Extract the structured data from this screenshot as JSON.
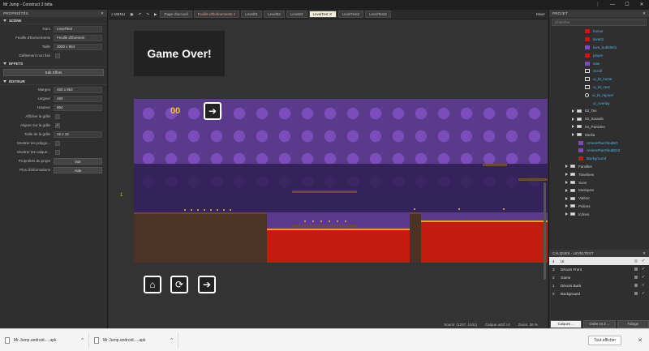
{
  "window": {
    "title": "Mr Jump - Construct 3 béta",
    "more": "⋮",
    "minimize": "—",
    "maximize": "☐",
    "close": "✕"
  },
  "properties": {
    "header": "PROPRIÉTÉS",
    "close": "✕",
    "scene_title": "SCÈNE",
    "effects_title": "EFFETS",
    "editor_title": "ÉDITEUR",
    "rows": {
      "name_label": "Nom",
      "name_value": "LevelTest",
      "sheet_label": "Feuille d'Événements",
      "sheet_value": "Feuille d'Événem",
      "size_label": "Taille",
      "size_value": "3000 x 854",
      "unbounded_label": "Défilement non fixé",
      "edit_effects": "Edit Effets",
      "margins_label": "Marges",
      "margins_value": "450 x 854",
      "width_label": "Largeur",
      "width_value": "450",
      "height_label": "Hauteur",
      "height_value": "854",
      "show_grid_label": "Afficher la grille",
      "snap_grid_label": "Aligner sur la grille",
      "snap_grid_check": "✓",
      "grid_size_label": "Taille de la grille",
      "grid_size_value": "16 x 16",
      "show_poly_label": "Montrer les polygo...",
      "show_layers_label": "Montrer les calque...",
      "project_props_label": "Propriétés du projet",
      "project_props_btn": "Voir",
      "more_info_label": "Plus d'informations",
      "more_info_btn": "Aide"
    }
  },
  "toolbar": {
    "menu": "≡ MENU",
    "tabs": [
      "Page d'accueil",
      "Feuille d'Événements 1",
      "Level01",
      "Level02",
      "Level03",
      "LevelTest",
      "LevelTest2",
      "LevelTest3"
    ],
    "active_close": "✕",
    "right": "Mixer"
  },
  "canvas": {
    "game_over": "Game Over!",
    "score": "00",
    "arrow": "➔",
    "home": "⌂",
    "restart": "⟳",
    "next": "➔",
    "side_marker": "1",
    "status": {
      "mouse": "Souris: (1207, 1041)",
      "layer": "Calque actif: UI",
      "zoom": "Zoom: 36 %"
    }
  },
  "project": {
    "header": "PROJET",
    "close": "✕",
    "search_placeholder": "Chercher",
    "items": [
      {
        "label": "bonus",
        "type": "sprite",
        "icon": "red"
      },
      {
        "label": "lava01",
        "type": "sprite",
        "icon": "red"
      },
      {
        "label": "lava_bubble01",
        "type": "sprite",
        "icon": "purple"
      },
      {
        "label": "player",
        "type": "sprite",
        "icon": "red"
      },
      {
        "label": "saw",
        "type": "sprite",
        "icon": "purple"
      },
      {
        "label": "Scroll",
        "type": "sprite",
        "icon": "rect"
      },
      {
        "label": "ui_bt_home",
        "type": "sprite",
        "icon": "rect"
      },
      {
        "label": "ui_bt_next",
        "type": "sprite",
        "icon": "rect"
      },
      {
        "label": "ui_bt_rejouer",
        "type": "sprite",
        "icon": "ring"
      },
      {
        "label": "ui_overlay",
        "type": "sprite",
        "icon": "none"
      },
      {
        "label": "03_Tex",
        "type": "folder"
      },
      {
        "label": "03_Sounds",
        "type": "folder"
      },
      {
        "label": "04_Particles",
        "type": "folder"
      },
      {
        "label": "Media",
        "type": "folder"
      },
      {
        "label": "ArrierePlanTiledBG",
        "type": "sprite",
        "icon": "purple"
      },
      {
        "label": "ArrierePlanTiledBG2",
        "type": "sprite",
        "icon": "purple"
      },
      {
        "label": "Background",
        "type": "sprite",
        "icon": "red"
      },
      {
        "label": "Familles",
        "type": "folder"
      },
      {
        "label": "Timelines",
        "type": "folder"
      },
      {
        "label": "Sons",
        "type": "folder"
      },
      {
        "label": "Musiques",
        "type": "folder"
      },
      {
        "label": "Vidéos",
        "type": "folder"
      },
      {
        "label": "Polices",
        "type": "folder"
      },
      {
        "label": "Icônes",
        "type": "folder"
      }
    ]
  },
  "layers": {
    "header": "CALQUES - LEVELTEST",
    "close": "✕",
    "check": "✓",
    "list": [
      {
        "num": "4",
        "name": "UI"
      },
      {
        "num": "3",
        "name": "Décors Front"
      },
      {
        "num": "2",
        "name": "Game"
      },
      {
        "num": "1",
        "name": "Décors Back"
      },
      {
        "num": "0",
        "name": "Background"
      }
    ]
  },
  "right_tabs": [
    "Calques ...",
    "Ordre en Z ...",
    "Tuilage"
  ],
  "downloads": {
    "items": [
      "Mr Jump.android.....apk",
      "Mr Jump.android.....apk"
    ],
    "chevron": "^",
    "show_all": "Tout afficher",
    "close": "✕"
  },
  "colors": {
    "accent_tab": "#f2f0d9",
    "lava": "#c41b10",
    "coin": "#f2c12e",
    "sky": "#5a3a8a"
  }
}
